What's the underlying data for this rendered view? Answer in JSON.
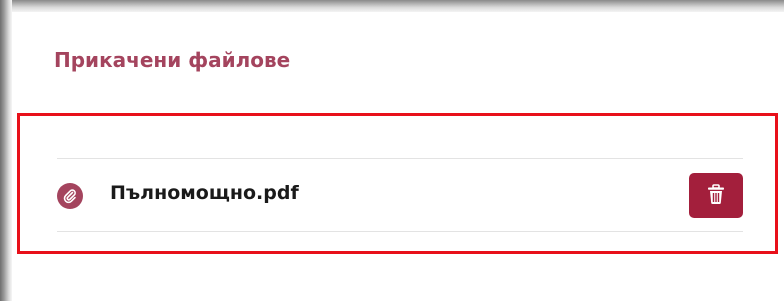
{
  "section": {
    "title": "Прикачени файлове"
  },
  "attachments": [
    {
      "file_name": "Пълномощно.pdf",
      "icon": "paperclip-icon",
      "action_icon": "trash-icon"
    }
  ],
  "colors": {
    "accent": "#a4445e",
    "delete_button": "#a31f3c",
    "highlight_border": "#e8101a"
  }
}
